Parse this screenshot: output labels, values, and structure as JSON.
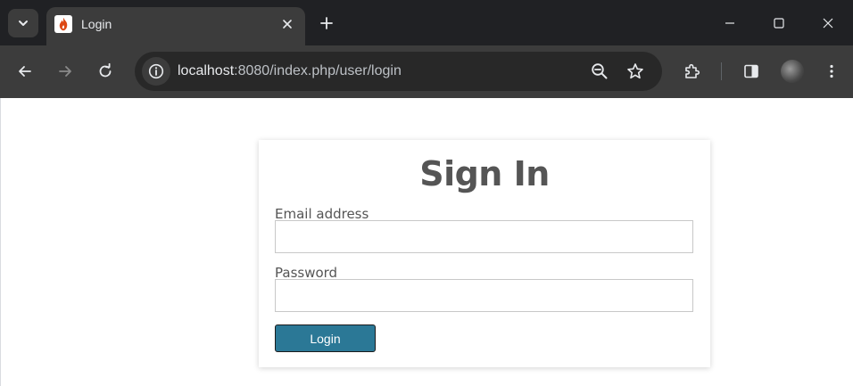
{
  "browser": {
    "tab": {
      "title": "Login",
      "favicon": "codeigniter-flame-icon"
    },
    "address_bar": {
      "host": "localhost",
      "rest": ":8080/index.php/user/login"
    },
    "colors": {
      "chrome_dark": "#202124",
      "toolbar": "#3c3c3c",
      "omnibox": "#282828"
    }
  },
  "login_form": {
    "title": "Sign In",
    "email": {
      "label": "Email address",
      "value": "",
      "placeholder": ""
    },
    "password": {
      "label": "Password",
      "value": "",
      "placeholder": ""
    },
    "submit_label": "Login",
    "colors": {
      "button": "#2b7896",
      "title_text": "#555555"
    }
  }
}
